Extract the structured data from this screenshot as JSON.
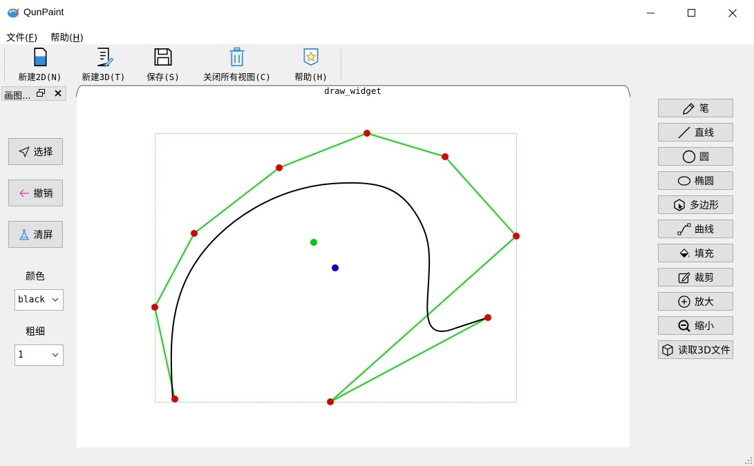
{
  "window": {
    "title": "QunPaint"
  },
  "menubar": {
    "items": [
      {
        "label": "文件(F)",
        "mnemonic_letter": "F"
      },
      {
        "label": "帮助(H)",
        "mnemonic_letter": "H"
      }
    ]
  },
  "toolbar": {
    "buttons": [
      {
        "label": "新建2D(N)",
        "icon": "new-2d-file-icon"
      },
      {
        "label": "新建3D(T)",
        "icon": "new-3d-document-icon"
      },
      {
        "label": "保存(S)",
        "icon": "save-floppy-icon"
      },
      {
        "label": "关闭所有视图(C)",
        "icon": "trash-icon"
      },
      {
        "label": "帮助(H)",
        "icon": "star-badge-icon"
      }
    ]
  },
  "dock": {
    "title": "画图...",
    "buttons": [
      {
        "label": "选择",
        "icon": "cursor-arrow-icon"
      },
      {
        "label": "撤销",
        "icon": "arrow-left-icon"
      },
      {
        "label": "清屏",
        "icon": "flask-icon"
      }
    ],
    "color_label": "颜色",
    "color_value": "black",
    "width_label": "粗细",
    "width_value": "1"
  },
  "canvas": {
    "tab_label": "draw_widget"
  },
  "tools": [
    {
      "label": "笔",
      "icon": "pencil-icon"
    },
    {
      "label": "直线",
      "icon": "line-icon"
    },
    {
      "label": "圆",
      "icon": "circle-icon"
    },
    {
      "label": "椭圆",
      "icon": "ellipse-icon"
    },
    {
      "label": "多边形",
      "icon": "polygon-icon"
    },
    {
      "label": "曲线",
      "icon": "curve-icon"
    },
    {
      "label": "填充",
      "icon": "fill-bucket-icon"
    },
    {
      "label": "裁剪",
      "icon": "crop-edit-icon"
    },
    {
      "label": "放大",
      "icon": "zoom-in-icon"
    },
    {
      "label": "缩小",
      "icon": "zoom-out-icon"
    },
    {
      "label": "读取3D文件",
      "icon": "cube-icon"
    }
  ],
  "colors": {
    "control_polygon": "#00e000",
    "control_point": "#e00000",
    "curve": "#000000",
    "centroid": "#00cc00",
    "rotation_center": "#0000dd"
  }
}
